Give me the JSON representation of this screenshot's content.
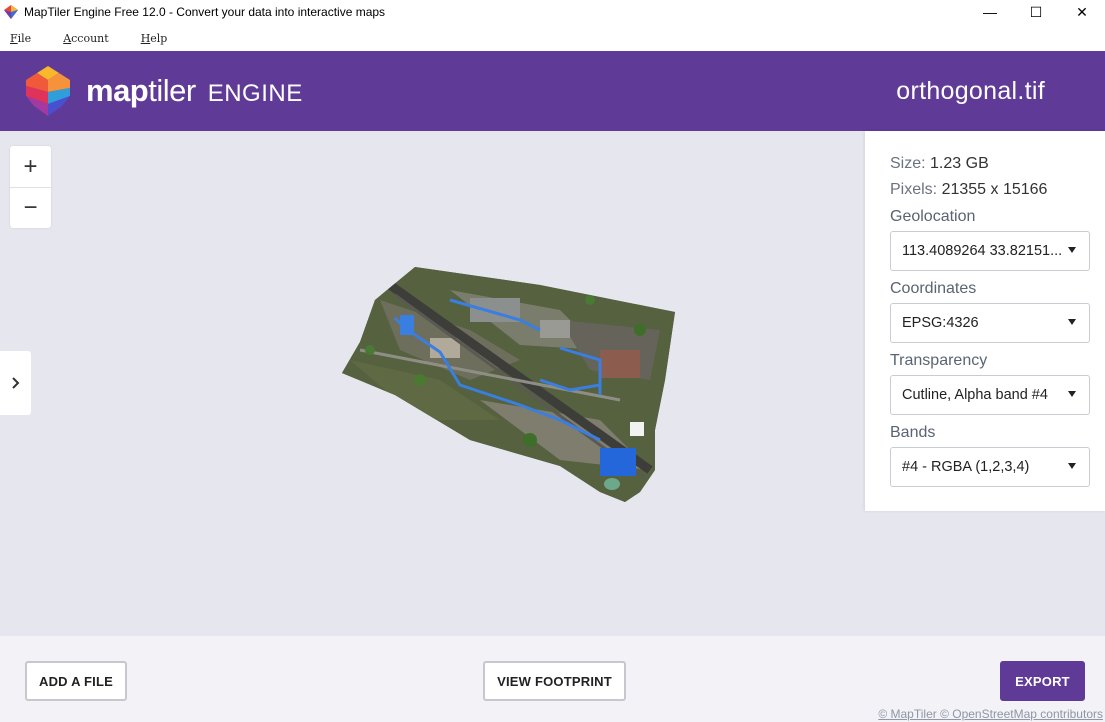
{
  "window": {
    "title": "MapTiler Engine Free 12.0 - Convert your data into interactive maps",
    "minimize_glyph": "—",
    "maximize_glyph": "☐",
    "close_glyph": "✕"
  },
  "menu": {
    "file_first": "F",
    "file_rest": "ile",
    "account_first": "A",
    "account_rest": "ccount",
    "help_first": "H",
    "help_rest": "elp"
  },
  "header": {
    "brand_map": "map",
    "brand_tiler": "tiler",
    "brand_engine": "ENGINE",
    "filename": "orthogonal.tif"
  },
  "map": {
    "zoom_in": "+",
    "zoom_out": "−"
  },
  "panel": {
    "size_label": "Size:",
    "size_value": "1.23 GB",
    "pixels_label": "Pixels:",
    "pixels_value": "21355 x 15166",
    "geolocation_label": "Geolocation",
    "geolocation_value": "113.4089264 33.82151...",
    "coordinates_label": "Coordinates",
    "coordinates_value": "EPSG:4326",
    "transparency_label": "Transparency",
    "transparency_value": "Cutline, Alpha band #4",
    "bands_label": "Bands",
    "bands_value": "#4 - RGBA (1,2,3,4)"
  },
  "footer": {
    "add_file": "ADD A FILE",
    "view_footprint": "VIEW FOOTPRINT",
    "export": "EXPORT",
    "attribution": "© MapTiler © OpenStreetMap contributors"
  },
  "colors": {
    "brand_purple": "#5f3a97",
    "map_background": "#e6e6ef"
  },
  "icons": [
    "maptiler-logo-icon",
    "chevron-right-icon",
    "dropdown-caret-icon",
    "minimize-icon",
    "maximize-icon",
    "close-icon"
  ]
}
